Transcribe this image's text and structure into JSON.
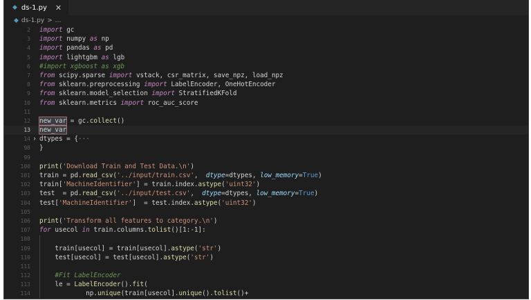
{
  "tab": {
    "icon": "python-file-icon",
    "title": "ds-1.py",
    "close": "✕"
  },
  "breadcrumb": {
    "file": "ds-1.py",
    "sep": ">",
    "rest": "..."
  },
  "colors": {
    "editor_bg": "#1e1e1e",
    "keyword": "#c586c0",
    "string": "#ce9178",
    "comment": "#6a9955",
    "function": "#dcdcaa"
  },
  "lines": [
    {
      "n": "2",
      "t": [
        [
          "kw",
          "import"
        ],
        [
          "p",
          " gc"
        ]
      ]
    },
    {
      "n": "3",
      "t": [
        [
          "kw",
          "import"
        ],
        [
          "p",
          " numpy "
        ],
        [
          "kw",
          "as"
        ],
        [
          "p",
          " np"
        ]
      ]
    },
    {
      "n": "4",
      "t": [
        [
          "kw",
          "import"
        ],
        [
          "p",
          " pandas "
        ],
        [
          "kw",
          "as"
        ],
        [
          "p",
          " pd"
        ]
      ]
    },
    {
      "n": "5",
      "t": [
        [
          "kw",
          "import"
        ],
        [
          "p",
          " lightgbm "
        ],
        [
          "kw",
          "as"
        ],
        [
          "p",
          " lgb"
        ]
      ]
    },
    {
      "n": "6",
      "t": [
        [
          "cm",
          "#import xgboost as xgb"
        ]
      ]
    },
    {
      "n": "7",
      "t": [
        [
          "kw",
          "from"
        ],
        [
          "p",
          " scipy.sparse "
        ],
        [
          "kw",
          "import"
        ],
        [
          "p",
          " vstack, csr_matrix, save_npz, load_npz"
        ]
      ]
    },
    {
      "n": "8",
      "t": [
        [
          "kw",
          "from"
        ],
        [
          "p",
          " sklearn.preprocessing "
        ],
        [
          "kw",
          "import"
        ],
        [
          "p",
          " LabelEncoder, OneHotEncoder"
        ]
      ]
    },
    {
      "n": "9",
      "t": [
        [
          "kw",
          "from"
        ],
        [
          "p",
          " sklearn.model_selection "
        ],
        [
          "kw",
          "import"
        ],
        [
          "p",
          " StratifiedKFold"
        ]
      ]
    },
    {
      "n": "10",
      "t": [
        [
          "kw",
          "from"
        ],
        [
          "p",
          " sklearn.metrics "
        ],
        [
          "kw",
          "import"
        ],
        [
          "p",
          " roc_auc_score"
        ]
      ]
    },
    {
      "n": "11",
      "t": []
    },
    {
      "n": "12",
      "t": [
        [
          "sel",
          "new_var"
        ],
        [
          "p",
          " = gc."
        ],
        [
          "fn",
          "collect"
        ],
        [
          "p",
          "()"
        ]
      ]
    },
    {
      "n": "13",
      "active": true,
      "t": [
        [
          "sel",
          "new_var"
        ]
      ]
    },
    {
      "n": "14",
      "fold": "›",
      "t": [
        [
          "p",
          "dtypes = {"
        ],
        [
          "dots",
          "···"
        ]
      ]
    },
    {
      "n": "98",
      "t": [
        [
          "p",
          "}"
        ]
      ]
    },
    {
      "n": "99",
      "t": []
    },
    {
      "n": "100",
      "t": [
        [
          "fn",
          "print"
        ],
        [
          "p",
          "("
        ],
        [
          "str",
          "'Download Train and Test Data.\\n'"
        ],
        [
          "p",
          ")"
        ]
      ]
    },
    {
      "n": "101",
      "t": [
        [
          "p",
          "train = pd."
        ],
        [
          "fn",
          "read_csv"
        ],
        [
          "p",
          "("
        ],
        [
          "str",
          "'../input/train.csv'"
        ],
        [
          "p",
          ",  "
        ],
        [
          "param",
          "dtype"
        ],
        [
          "p",
          "=dtypes, "
        ],
        [
          "param",
          "low_memory"
        ],
        [
          "p",
          "="
        ],
        [
          "bool",
          "True"
        ],
        [
          "p",
          ")"
        ]
      ]
    },
    {
      "n": "102",
      "t": [
        [
          "p",
          "train["
        ],
        [
          "str",
          "'MachineIdentifier'"
        ],
        [
          "p",
          "] = train.index."
        ],
        [
          "fn",
          "astype"
        ],
        [
          "p",
          "("
        ],
        [
          "str",
          "'uint32'"
        ],
        [
          "p",
          ")"
        ]
      ]
    },
    {
      "n": "103",
      "t": [
        [
          "p",
          "test  = pd."
        ],
        [
          "fn",
          "read_csv"
        ],
        [
          "p",
          "("
        ],
        [
          "str",
          "'../input/test.csv'"
        ],
        [
          "p",
          ",  "
        ],
        [
          "param",
          "dtype"
        ],
        [
          "p",
          "=dtypes, "
        ],
        [
          "param",
          "low_memory"
        ],
        [
          "p",
          "="
        ],
        [
          "bool",
          "True"
        ],
        [
          "p",
          ")"
        ]
      ]
    },
    {
      "n": "104",
      "t": [
        [
          "p",
          "test["
        ],
        [
          "str",
          "'MachineIdentifier'"
        ],
        [
          "p",
          "]  = test.index."
        ],
        [
          "fn",
          "astype"
        ],
        [
          "p",
          "("
        ],
        [
          "str",
          "'uint32'"
        ],
        [
          "p",
          ")"
        ]
      ]
    },
    {
      "n": "105",
      "t": []
    },
    {
      "n": "106",
      "t": [
        [
          "fn",
          "print"
        ],
        [
          "p",
          "("
        ],
        [
          "str",
          "'Transform all features to category.\\n'"
        ],
        [
          "p",
          ")"
        ]
      ]
    },
    {
      "n": "107",
      "t": [
        [
          "kw",
          "for"
        ],
        [
          "p",
          " usecol "
        ],
        [
          "kw",
          "in"
        ],
        [
          "p",
          " train.columns."
        ],
        [
          "fn",
          "tolist"
        ],
        [
          "p",
          "()[1:-1]:"
        ]
      ]
    },
    {
      "n": "108",
      "t": []
    },
    {
      "n": "109",
      "t": [
        [
          "p",
          "    train[usecol] = train[usecol]."
        ],
        [
          "fn",
          "astype"
        ],
        [
          "p",
          "("
        ],
        [
          "str",
          "'str'"
        ],
        [
          "p",
          ")"
        ]
      ]
    },
    {
      "n": "110",
      "t": [
        [
          "p",
          "    test[usecol] = test[usecol]."
        ],
        [
          "fn",
          "astype"
        ],
        [
          "p",
          "("
        ],
        [
          "str",
          "'str'"
        ],
        [
          "p",
          ")"
        ]
      ]
    },
    {
      "n": "111",
      "t": []
    },
    {
      "n": "112",
      "t": [
        [
          "cm",
          "    #Fit LabelEncoder"
        ]
      ]
    },
    {
      "n": "113",
      "t": [
        [
          "p",
          "    le = "
        ],
        [
          "fn",
          "LabelEncoder"
        ],
        [
          "p",
          "()."
        ],
        [
          "fn",
          "fit"
        ],
        [
          "p",
          "("
        ]
      ]
    },
    {
      "n": "114",
      "t": [
        [
          "p",
          "            np."
        ],
        [
          "fn",
          "unique"
        ],
        [
          "p",
          "(train[usecol]."
        ],
        [
          "fn",
          "unique"
        ],
        [
          "p",
          "()."
        ],
        [
          "fn",
          "tolist"
        ],
        [
          "p",
          "()+"
        ]
      ]
    }
  ]
}
